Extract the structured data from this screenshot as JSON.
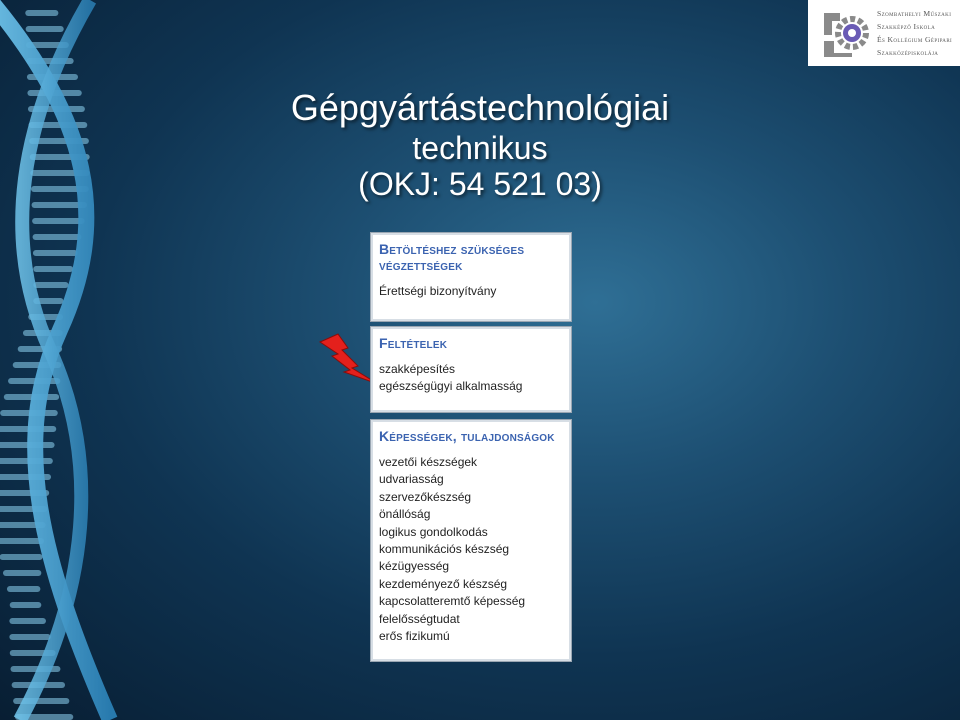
{
  "logo": {
    "lines": [
      "Szombathelyi Műszaki",
      "Szakképző Iskola",
      "És Kollégium Gépipari",
      "Szakközépiskolája"
    ]
  },
  "title": {
    "line1": "Gépgyártástechnológiai",
    "line2": "technikus",
    "line3": "(OKJ: 54 521 03)"
  },
  "sections": [
    {
      "heading1": "Betöltéshez szükséges",
      "heading2": "végzettségek",
      "items": [
        "Érettségi bizonyítvány"
      ]
    },
    {
      "heading1": "Feltételek",
      "items": [
        "szakképesítés",
        "egészségügyi alkalmasság"
      ]
    },
    {
      "heading1": "Képességek, tulajdonságok",
      "items": [
        "vezetői készségek",
        "udvariasság",
        "szervezőkészség",
        "önállóság",
        "logikus gondolkodás",
        "kommunikációs készség",
        "kézügyesség",
        "kezdeményező készség",
        "kapcsolatteremtő képesség",
        "felelősségtudat",
        "erős fizikumú"
      ]
    }
  ],
  "icons": {
    "helix": "dna-helix-icon",
    "bolt": "lightning-bolt-icon",
    "gear": "gear-icon"
  },
  "colors": {
    "heading": "#3b63b0",
    "bolt": "#e4201c",
    "emblem": "#6a5bb5"
  }
}
